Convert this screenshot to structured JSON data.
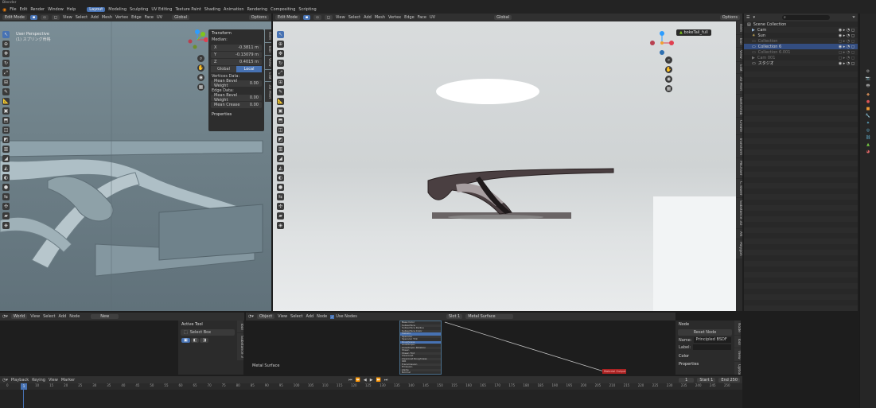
{
  "app": {
    "title": "Blender"
  },
  "menu": [
    "File",
    "Edit",
    "Render",
    "Window",
    "Help"
  ],
  "workspace_tabs": [
    {
      "label": "Layout",
      "active": true
    },
    {
      "label": "Modeling",
      "active": false
    },
    {
      "label": "Sculpting",
      "active": false
    },
    {
      "label": "UV Editing",
      "active": false
    },
    {
      "label": "Texture Paint",
      "active": false
    },
    {
      "label": "Shading",
      "active": false
    },
    {
      "label": "Animation",
      "active": false
    },
    {
      "label": "Rendering",
      "active": false
    },
    {
      "label": "Compositing",
      "active": false
    },
    {
      "label": "Scripting",
      "active": false
    }
  ],
  "viewport_left": {
    "mode": "Edit Mode",
    "menu": [
      "View",
      "Select",
      "Add",
      "Mesh",
      "Vertex",
      "Edge",
      "Face",
      "UV"
    ],
    "orientation": "Global",
    "options": "Options",
    "overlay_title": "User Perspective",
    "overlay_sub": "(1) スプリング骨格",
    "side_tabs": [
      "Item",
      "Tool",
      "View",
      "Edit",
      "3D Print"
    ],
    "transform_panel": {
      "title": "Transform",
      "median_label": "Median:",
      "rows": [
        {
          "axis": "X",
          "value": "-0.3811 m"
        },
        {
          "axis": "Y",
          "value": "-0.13079 m"
        },
        {
          "axis": "Z",
          "value": "0.4015 m"
        }
      ],
      "global_label": "Global",
      "local_label": "Local",
      "vertices_data": "Vertices Data:",
      "mean_bevel_weight_v": {
        "label": "Mean Bevel Weight",
        "value": "0.00"
      },
      "edges_data": "Edge Data:",
      "mean_bevel_weight_e": {
        "label": "Mean Bevel Weight",
        "value": "0.00"
      },
      "mean_crease": {
        "label": "Mean Crease",
        "value": "0.00"
      },
      "properties": "Properties"
    }
  },
  "viewport_right": {
    "mode": "Edit Mode",
    "menu": [
      "View",
      "Select",
      "Add",
      "Mesh",
      "Vertex",
      "Edge",
      "Face",
      "UV"
    ],
    "orientation": "Global",
    "options": "Options",
    "object_name": "bokeTail_full",
    "side_tabs": [
      "Item",
      "Tool",
      "View",
      "Edit",
      "3D Print",
      "Sketchfab",
      "Create",
      "Transform",
      "MiChaer",
      "C.Tower",
      "Substance 3D",
      "AN",
      "Polygon"
    ]
  },
  "outliner": {
    "search_placeholder": "",
    "items": [
      {
        "label": "Scene Collection",
        "indent": 0,
        "sel": false
      },
      {
        "label": "Cam",
        "indent": 1,
        "sel": false
      },
      {
        "label": "Sun",
        "indent": 1,
        "sel": false
      },
      {
        "label": "Collection",
        "indent": 1,
        "sel": false
      },
      {
        "label": "Collection 6",
        "indent": 1,
        "sel": true
      },
      {
        "label": "Collection 6.001",
        "indent": 1,
        "sel": false
      },
      {
        "label": "Cam 001",
        "indent": 1,
        "sel": false
      },
      {
        "label": "スタジオ",
        "indent": 1,
        "sel": false
      }
    ]
  },
  "image_editor": {
    "mode": "World",
    "menu": [
      "View",
      "Select",
      "Add",
      "Node"
    ],
    "new_label": "New",
    "active_tool_title": "Active Tool",
    "select_box": "Select Box",
    "side_tabs": [
      "Tool",
      "Substance 3"
    ]
  },
  "shader_editor": {
    "mode": "Object",
    "menu": [
      "View",
      "Select",
      "Add",
      "Node"
    ],
    "use_nodes": "Use Nodes",
    "slot": "Slot 1",
    "material": "Metal Surface",
    "node_label": "Metal Surface",
    "output_node": "Material Output",
    "node_rows": [
      "Base Color",
      "Subsurface",
      "Subsurface Radius",
      "Subsurface Color",
      "Metallic",
      "Specular",
      "Specular Tint",
      "Roughness",
      "Anisotropic",
      "Anisotropic Rotation",
      "Sheen",
      "Sheen Tint",
      "Clearcoat",
      "Clearcoat Roughness",
      "IOR",
      "Transmission",
      "Emission",
      "Alpha",
      "Normal"
    ]
  },
  "node_panel": {
    "title": "Node",
    "reset_node": "Reset Node",
    "name_label": "Name:",
    "name_value": "Principled BSDF",
    "label_label": "Label:",
    "color_section": "Color",
    "properties": "Properties",
    "side_tabs": [
      "Node",
      "Tool",
      "View",
      "Options"
    ]
  },
  "timeline": {
    "menu": [
      "Playback",
      "Keying",
      "View",
      "Marker"
    ],
    "current_frame": "1",
    "start_label": "Start",
    "start": "1",
    "end_label": "End",
    "end": "250",
    "ticks": [
      "0",
      "5",
      "10",
      "15",
      "20",
      "25",
      "30",
      "35",
      "40",
      "45",
      "50",
      "55",
      "60",
      "65",
      "70",
      "75",
      "80",
      "85",
      "90",
      "95",
      "100",
      "105",
      "110",
      "115",
      "120",
      "125",
      "130",
      "135",
      "140",
      "145",
      "150",
      "155",
      "160",
      "165",
      "170",
      "175",
      "180",
      "185",
      "190",
      "195",
      "200",
      "205",
      "210",
      "215",
      "220",
      "225",
      "230",
      "235",
      "240",
      "245",
      "250"
    ]
  },
  "colors": {
    "accent": "#4772b3",
    "header": "#303030",
    "bg": "#1d1d1d",
    "panel": "#2b2b2b"
  }
}
